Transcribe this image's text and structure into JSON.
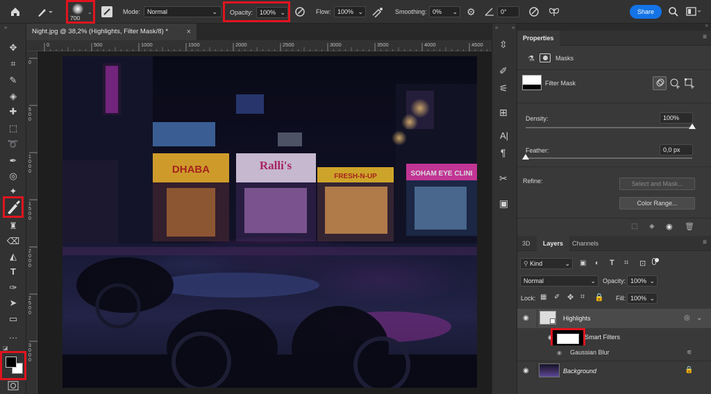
{
  "options_bar": {
    "brush_size": "700",
    "mode_label": "Mode:",
    "mode_value": "Normal",
    "opacity_label": "Opacity:",
    "opacity_value": "100%",
    "flow_label": "Flow:",
    "flow_value": "100%",
    "smoothing_label": "Smoothing:",
    "smoothing_value": "0%",
    "angle_value": "0°",
    "share_label": "Share"
  },
  "document": {
    "tab_title": "Night.jpg @ 38,2% (Highlights, Filter Mask/8) *",
    "close_glyph": "×",
    "ruler_top": [
      "0",
      "500",
      "1000",
      "1500",
      "2000",
      "2500",
      "3000",
      "3500",
      "4000",
      "4500"
    ],
    "ruler_left": [
      "0",
      "5\n0\n0",
      "1\n0\n0\n0",
      "1\n5\n0\n0",
      "2\n0\n0\n0",
      "2\n5\n0\n0",
      "3\n0\n0\n0"
    ]
  },
  "properties": {
    "title": "Properties",
    "masks_label": "Masks",
    "filter_mask_label": "Filter Mask",
    "density_label": "Density:",
    "density_value": "100%",
    "density_level": 1.0,
    "feather_label": "Feather:",
    "feather_value": "0,0 px",
    "feather_level": 0.0,
    "refine_label": "Refine:",
    "select_and_mask_label": "Select and Mask...",
    "color_range_label": "Color Range..."
  },
  "layers": {
    "tabs": [
      "3D",
      "Layers",
      "Channels"
    ],
    "active_tab": "Layers",
    "kind_filter": "Kind",
    "blend_mode": "Normal",
    "opacity_label": "Opacity:",
    "opacity_value": "100%",
    "lock_label": "Lock:",
    "fill_label": "Fill:",
    "fill_value": "100%",
    "items": [
      {
        "name": "Highlights",
        "visible": true
      },
      {
        "name": "Smart Filters",
        "visible": true
      },
      {
        "name": "Gaussian Blur",
        "visible": true
      },
      {
        "name": "Background",
        "visible": true
      }
    ]
  },
  "colors": {
    "accent": "#1473e6",
    "highlight_red": "#e0141e",
    "panel_bg": "#393939",
    "chrome_bg": "#323232"
  }
}
